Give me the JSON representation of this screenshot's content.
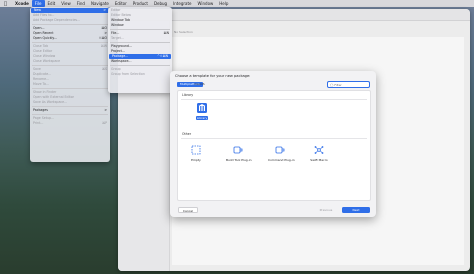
{
  "menubar": {
    "app": "Xcode",
    "items": [
      "File",
      "Edit",
      "View",
      "Find",
      "Navigate",
      "Editor",
      "Product",
      "Debug",
      "Integrate",
      "Window",
      "Help"
    ]
  },
  "window": {
    "no_selection": "No Selection"
  },
  "file_menu": {
    "items": [
      {
        "label": "New",
        "shortcut": ">",
        "state": "highlight"
      },
      {
        "label": "Add Files to...",
        "shortcut": "",
        "state": "dim"
      },
      {
        "label": "Add Package Dependencies...",
        "shortcut": "",
        "state": "dim"
      },
      {
        "sep": true
      },
      {
        "label": "Open...",
        "shortcut": "⌘O",
        "state": ""
      },
      {
        "label": "Open Recent",
        "shortcut": ">",
        "state": ""
      },
      {
        "label": "Open Quickly...",
        "shortcut": "⇧⌘O",
        "state": ""
      },
      {
        "sep": true
      },
      {
        "label": "Close Tab",
        "shortcut": "⌘W",
        "state": "dim"
      },
      {
        "label": "Close Editor",
        "shortcut": "",
        "state": "dim"
      },
      {
        "label": "Close Window",
        "shortcut": "",
        "state": "dim"
      },
      {
        "label": "Close Workspace",
        "shortcut": "",
        "state": "dim"
      },
      {
        "sep": true
      },
      {
        "label": "Save",
        "shortcut": "⌘S",
        "state": "dim"
      },
      {
        "label": "Duplicate...",
        "shortcut": "",
        "state": "dim"
      },
      {
        "label": "Rename...",
        "shortcut": "",
        "state": "dim"
      },
      {
        "label": "Move To...",
        "shortcut": "",
        "state": "dim"
      },
      {
        "sep": true
      },
      {
        "label": "Show in Finder",
        "shortcut": "",
        "state": "dim"
      },
      {
        "label": "Open with External Editor",
        "shortcut": "",
        "state": "dim"
      },
      {
        "label": "Save As Workspace...",
        "shortcut": "",
        "state": "dim"
      },
      {
        "sep": true
      },
      {
        "label": "Packages",
        "shortcut": ">",
        "state": ""
      },
      {
        "sep": true
      },
      {
        "label": "Page Setup...",
        "shortcut": "",
        "state": "dim"
      },
      {
        "label": "Print...",
        "shortcut": "⌘P",
        "state": "dim"
      }
    ]
  },
  "new_menu": {
    "items": [
      {
        "label": "Editor",
        "shortcut": "",
        "state": "dim"
      },
      {
        "label": "Editor Below",
        "shortcut": "",
        "state": "dim"
      },
      {
        "label": "Window Tab",
        "shortcut": "",
        "state": ""
      },
      {
        "label": "Window",
        "shortcut": "",
        "state": ""
      },
      {
        "sep": true
      },
      {
        "label": "File...",
        "shortcut": "⌘N",
        "state": ""
      },
      {
        "label": "Target...",
        "shortcut": "",
        "state": "dim"
      },
      {
        "sep": true
      },
      {
        "label": "Playground...",
        "shortcut": "",
        "state": ""
      },
      {
        "label": "Project...",
        "shortcut": "",
        "state": ""
      },
      {
        "label": "Package...",
        "shortcut": "^⇧⌘N",
        "state": "highlight"
      },
      {
        "label": "Workspace...",
        "shortcut": "",
        "state": ""
      },
      {
        "sep": true
      },
      {
        "label": "Group",
        "shortcut": "",
        "state": "dim"
      },
      {
        "label": "Group from Selection",
        "shortcut": "",
        "state": "dim"
      }
    ]
  },
  "sheet": {
    "title": "Choose a template for your new package:",
    "platform_tabs": [
      "Multiplatform",
      "macOS"
    ],
    "search_placeholder": "Filter",
    "sections": {
      "library": "Library",
      "other": "Other"
    },
    "templates": {
      "library": [
        "Library"
      ],
      "other": [
        "Empty",
        "Build Tool Plug-in",
        "Command Plug-in",
        "Swift Macro"
      ]
    },
    "buttons": {
      "cancel": "Cancel",
      "previous": "Previous",
      "next": "Next"
    }
  },
  "colors": {
    "accent": "#2f6ee8"
  }
}
